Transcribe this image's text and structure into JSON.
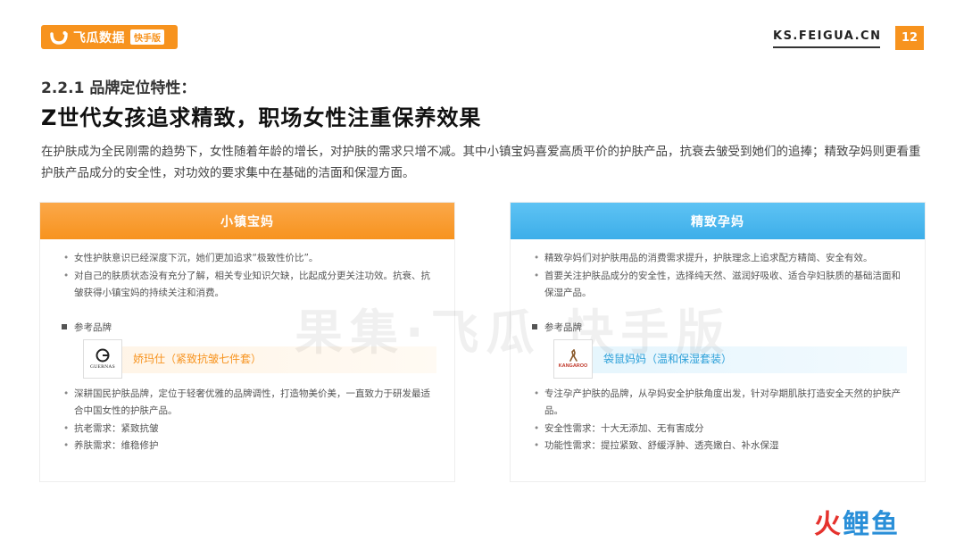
{
  "header": {
    "logo_text": "飞瓜数据",
    "logo_badge": "快手版",
    "site_url": "KS.FEIGUA.CN",
    "page_number": "12"
  },
  "section_label": "2.2.1 品牌定位特性：",
  "headline": "Z世代女孩追求精致，职场女性注重保养效果",
  "intro": "在护肤成为全民刚需的趋势下，女性随着年龄的增长，对护肤的需求只增不减。其中小镇宝妈喜爱高质平价的护肤产品，抗衰去皱受到她们的追捧；精致孕妈则更看重护肤产品成分的安全性，对功效的要求集中在基础的洁面和保湿方面。",
  "left_card": {
    "title": "小镇宝妈",
    "bullets_top": [
      "女性护肤意识已经深度下沉，她们更加追求“极致性价比”。",
      "对自己的肤质状态没有充分了解，相关专业知识欠缺，比起成分更关注功效。抗衰、抗皱获得小镇宝妈的持续关注和消费。"
    ],
    "ref_title": "参考品牌",
    "brand_logo_text": "GUERNAS",
    "brand_name": "娇玛仕（紧致抗皱七件套）",
    "bullets_bottom": [
      "深耕国民护肤品牌，定位于轻奢优雅的品牌调性，打造物美价美，一直致力于研发最适合中国女性的护肤产品。",
      "抗老需求：紧致抗皱",
      "养肤需求：维稳修护"
    ]
  },
  "right_card": {
    "title": "精致孕妈",
    "bullets_top": [
      "精致孕妈们对护肤用品的消费需求提升，护肤理念上追求配方精简、安全有效。",
      "首要关注护肤品成分的安全性，选择纯天然、滋润好吸收、适合孕妇肤质的基础洁面和保湿产品。"
    ],
    "ref_title": "参考品牌",
    "brand_logo_text": "KANGAROO",
    "brand_name": "袋鼠妈妈（温和保湿套装）",
    "bullets_bottom": [
      "专注孕产护肤的品牌，从孕妈安全护肤角度出发，针对孕期肌肤打造安全天然的护肤产品。",
      "安全性需求：十大无添加、无有害成分",
      "功能性需求：提拉紧致、舒缓浮肿、透亮嫩白、补水保湿"
    ]
  },
  "watermark": "果集·飞瓜 快手版",
  "corner_mark": {
    "part1": "火",
    "part2": "鲤鱼"
  },
  "colors": {
    "orange": "#f7931e",
    "blue": "#3daee9"
  }
}
